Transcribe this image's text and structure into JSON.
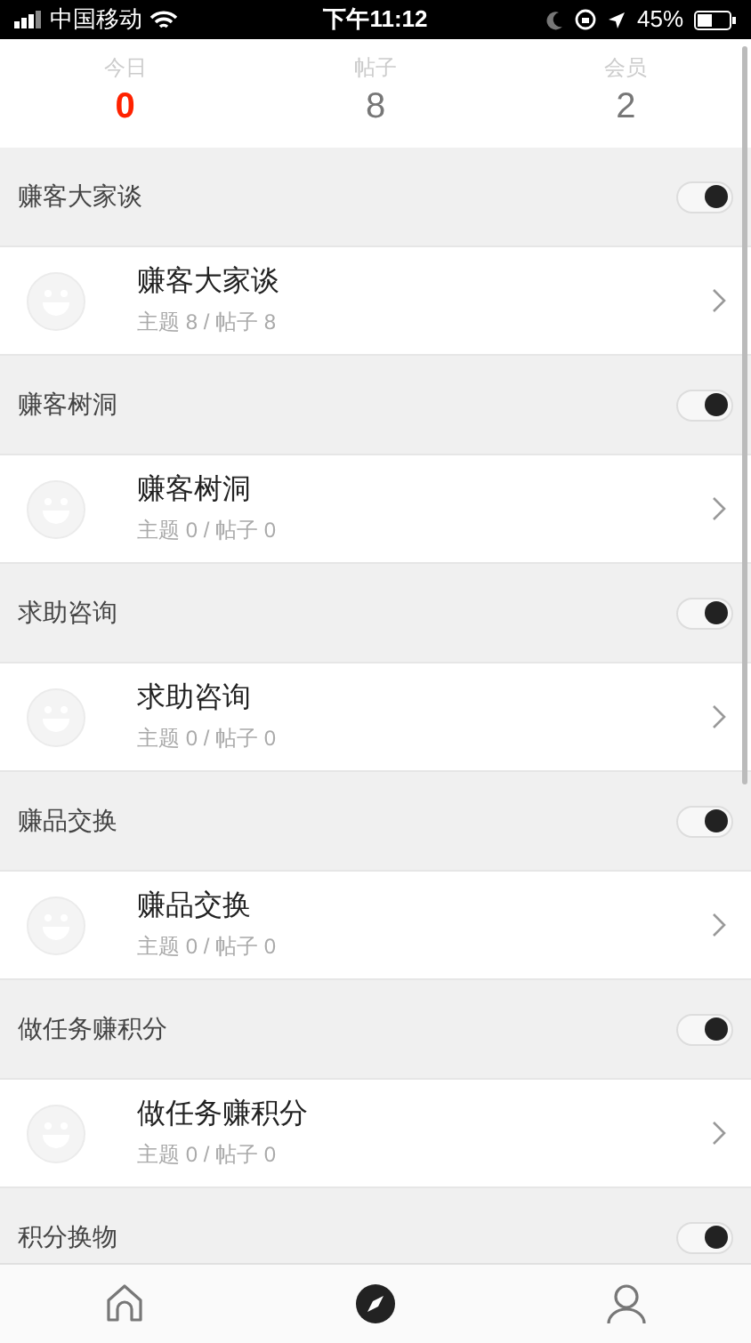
{
  "status_bar": {
    "carrier": "中国移动",
    "time": "下午11:12",
    "battery": "45%"
  },
  "stats": [
    {
      "label": "今日",
      "value": "0",
      "highlight": true
    },
    {
      "label": "帖子",
      "value": "8",
      "highlight": false
    },
    {
      "label": "会员",
      "value": "2",
      "highlight": false
    }
  ],
  "sections": [
    {
      "title": "赚客大家谈",
      "on": true,
      "forum": {
        "name": "赚客大家谈",
        "meta": "主题 8 / 帖子 8"
      }
    },
    {
      "title": "赚客树洞",
      "on": true,
      "forum": {
        "name": "赚客树洞",
        "meta": "主题 0 / 帖子 0"
      }
    },
    {
      "title": "求助咨询",
      "on": true,
      "forum": {
        "name": "求助咨询",
        "meta": "主题 0 / 帖子 0"
      }
    },
    {
      "title": "赚品交换",
      "on": true,
      "forum": {
        "name": "赚品交换",
        "meta": "主题 0 / 帖子 0"
      }
    },
    {
      "title": "做任务赚积分",
      "on": true,
      "forum": {
        "name": "做任务赚积分",
        "meta": "主题 0 / 帖子 0"
      }
    },
    {
      "title": "积分换物",
      "on": true
    }
  ],
  "tab_bar": [
    {
      "kind": "home",
      "selected": false
    },
    {
      "kind": "compass",
      "selected": true
    },
    {
      "kind": "person",
      "selected": false
    }
  ]
}
